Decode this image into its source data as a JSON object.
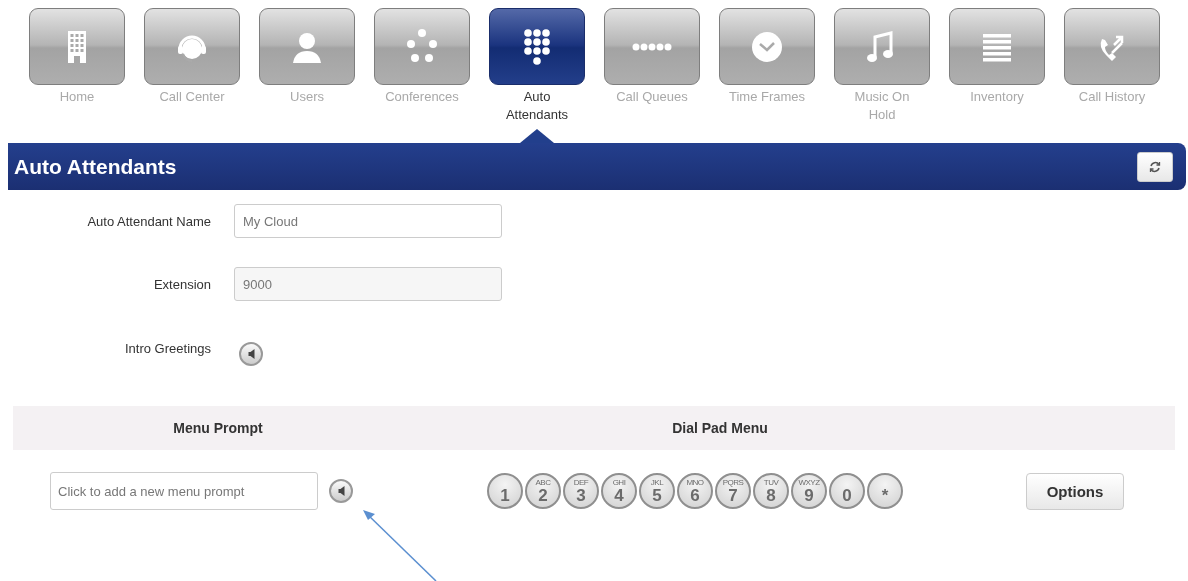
{
  "nav": [
    {
      "label": "Home",
      "selected": false
    },
    {
      "label": "Call Center",
      "selected": false
    },
    {
      "label": "Users",
      "selected": false
    },
    {
      "label": "Conferences",
      "selected": false
    },
    {
      "label": "Auto Attendants",
      "selected": true
    },
    {
      "label": "Call Queues",
      "selected": false
    },
    {
      "label": "Time Frames",
      "selected": false
    },
    {
      "label": "Music On Hold",
      "selected": false
    },
    {
      "label": "Inventory",
      "selected": false
    },
    {
      "label": "Call History",
      "selected": false
    }
  ],
  "header": {
    "title": "Auto Attendants"
  },
  "form": [
    {
      "label": "Auto Attendant Name",
      "kind": "text",
      "value": "My Cloud"
    },
    {
      "label": "Extension",
      "kind": "readonly",
      "value": "9000"
    },
    {
      "label": "Intro Greetings",
      "kind": "audio"
    }
  ],
  "menu_table": {
    "columns": [
      "Menu Prompt",
      "Dial Pad Menu"
    ],
    "prompt_placeholder": "Click to add a new menu prompt",
    "keys": [
      {
        "digit": "1"
      },
      {
        "digit": "2",
        "letters": "ABC"
      },
      {
        "digit": "3",
        "letters": "DEF"
      },
      {
        "digit": "4",
        "letters": "GHI"
      },
      {
        "digit": "5",
        "letters": "JKL"
      },
      {
        "digit": "6",
        "letters": "MNO"
      },
      {
        "digit": "7",
        "letters": "PQRS"
      },
      {
        "digit": "8",
        "letters": "TUV"
      },
      {
        "digit": "9",
        "letters": "WXYZ"
      },
      {
        "digit": "0"
      },
      {
        "digit": "*"
      }
    ],
    "options_button": "Options"
  }
}
